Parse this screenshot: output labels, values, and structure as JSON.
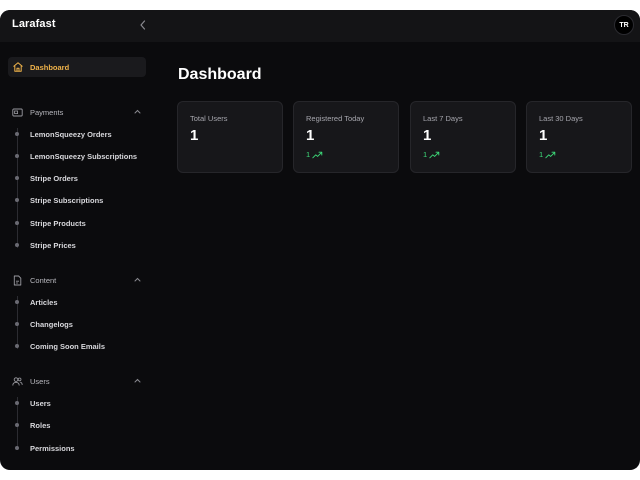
{
  "app": {
    "title": "Larafast"
  },
  "user": {
    "initials": "TR"
  },
  "colors": {
    "accent": "#f0b34a",
    "trend_up": "#3ddc7a",
    "background": "#0b0b0d"
  },
  "sidebar": {
    "active": {
      "label": "Dashboard",
      "icon": "home-icon"
    },
    "groups": [
      {
        "label": "Payments",
        "icon": "credit-card-icon",
        "items": [
          "LemonSqueezy Orders",
          "LemonSqueezy Subscriptions",
          "Stripe Orders",
          "Stripe Subscriptions",
          "Stripe Products",
          "Stripe Prices"
        ]
      },
      {
        "label": "Content",
        "icon": "document-icon",
        "items": [
          "Articles",
          "Changelogs",
          "Coming Soon Emails"
        ]
      },
      {
        "label": "Users",
        "icon": "users-icon",
        "items": [
          "Users",
          "Roles",
          "Permissions"
        ]
      }
    ]
  },
  "main": {
    "title": "Dashboard",
    "cards": [
      {
        "label": "Total Users",
        "value": "1",
        "trend": ""
      },
      {
        "label": "Registered Today",
        "value": "1",
        "trend": "1"
      },
      {
        "label": "Last 7 Days",
        "value": "1",
        "trend": "1"
      },
      {
        "label": "Last 30 Days",
        "value": "1",
        "trend": "1"
      }
    ]
  }
}
